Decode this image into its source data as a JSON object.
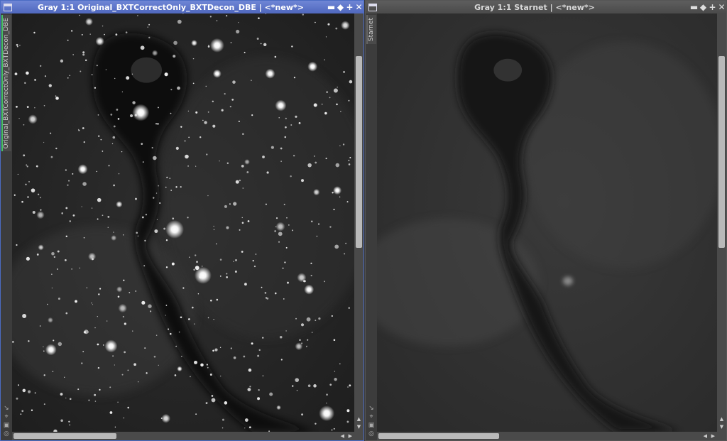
{
  "windows": [
    {
      "title": "Gray 1:1 Original_BXTCorrectOnly_BXTDecon_DBE | <*new*>",
      "tab_label": "Original_BXTCorrectOnly_BXTDecon_DBE",
      "image_icon": "nebula-with-stars-image",
      "active": true
    },
    {
      "title": "Gray 1:1 Starnet | <*new*>",
      "tab_label": "Starnet",
      "image_icon": "starless-nebula-image",
      "active": false
    }
  ],
  "controls": {
    "minimize": "▬",
    "maximize": "◆",
    "shade": "+",
    "close": "✕"
  },
  "colors": {
    "active_titlebar": "#5a72c8",
    "inactive_titlebar": "#555555",
    "active_tab_marker": "#46c16a"
  }
}
